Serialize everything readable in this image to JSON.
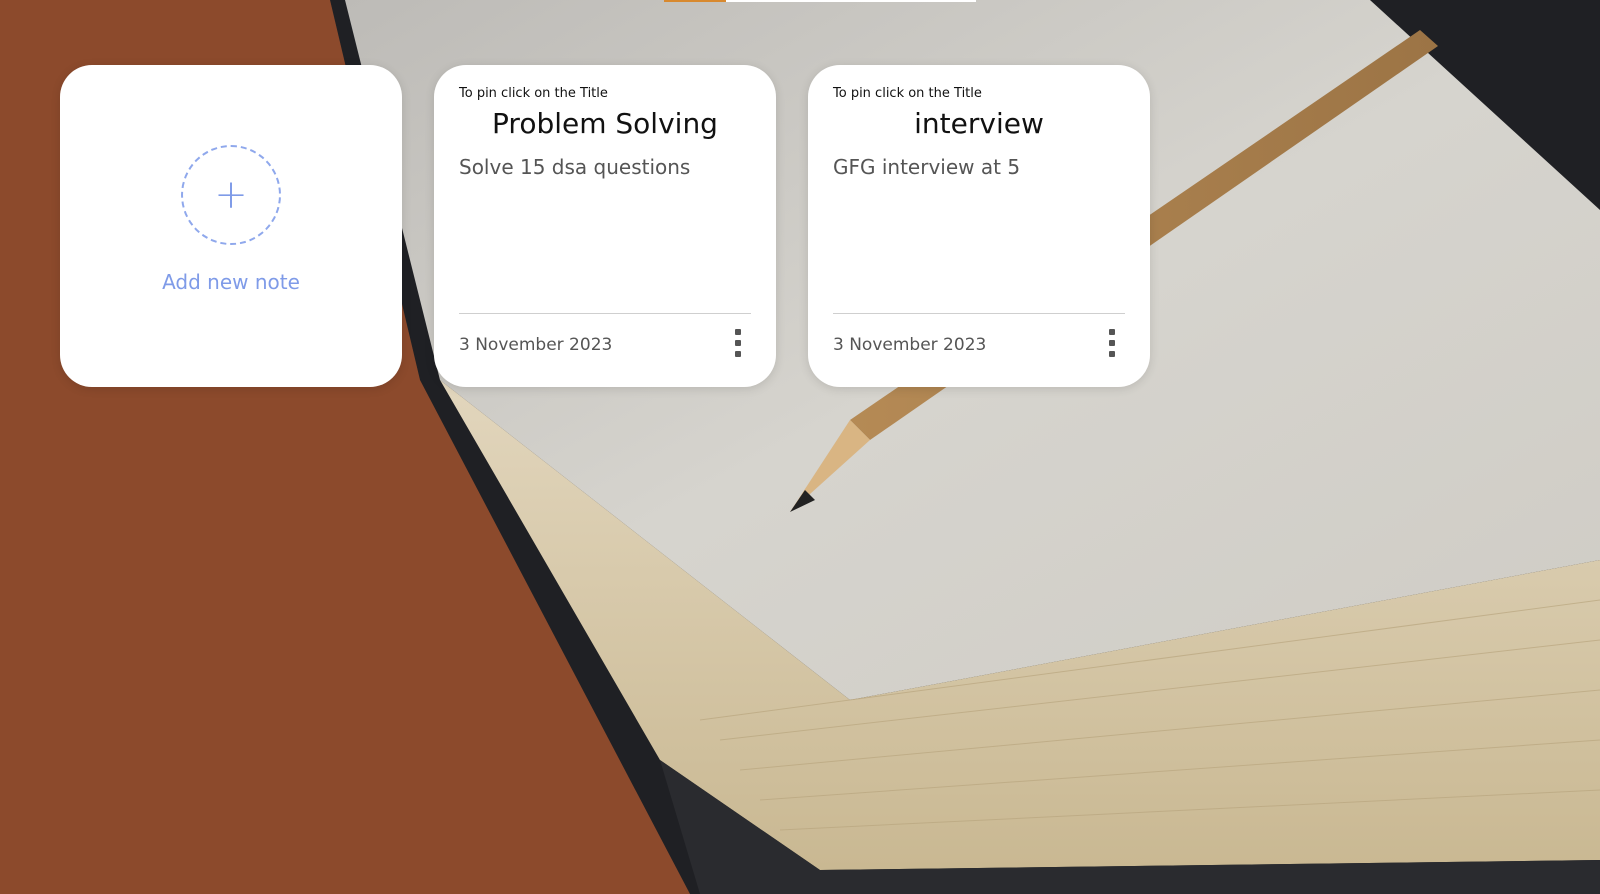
{
  "top_indicator": {
    "active_color": "#d8892f",
    "track_color": "#ffffff"
  },
  "add_card": {
    "plus_symbol": "+",
    "label": "Add new note",
    "accent_color": "#7f9be8"
  },
  "notes": [
    {
      "pin_hint": "To pin click on the Title",
      "title": "Problem Solving",
      "body": "Solve 15 dsa questions",
      "date": "3 November 2023",
      "menu_icon": "more-vertical-icon"
    },
    {
      "pin_hint": "To pin click on the Title",
      "title": "interview",
      "body": "GFG interview at 5",
      "date": "3 November 2023",
      "menu_icon": "more-vertical-icon"
    }
  ]
}
